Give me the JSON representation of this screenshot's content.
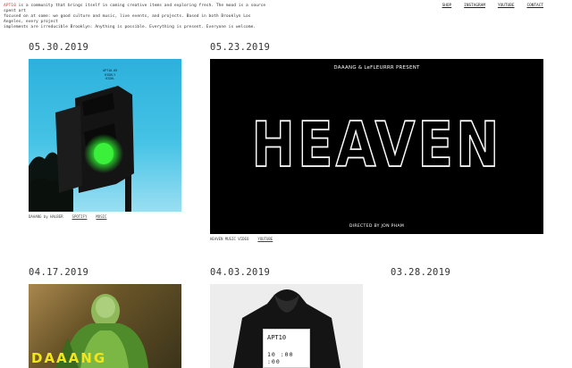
{
  "intro": {
    "brand": "APT10",
    "line1": " is a community that brings itself in coming creative items and exploring fresh. The mood is a source spent art",
    "line2": "focused on at some: we good culture and music, live events, and projects. Based in both Brooklyn Los Angeles, every project",
    "line3": "implements are irreducible Brooklyn: Anything is possible. Everything is present. Everyone is welcome."
  },
  "nav": {
    "shop": "SHOP",
    "instagram": "INSTAGRAM",
    "youtube": "YOUTUBE",
    "contact": "CONTACT"
  },
  "posts": [
    {
      "date": "05.30.2019",
      "image": {
        "label_line1": "APT10.05",
        "label_line2": "HIGHLY",
        "label_line3": "HIGHL"
      },
      "caption": "DAAANG by HALBER",
      "link1": "SPOTIFY",
      "link2": "MUSIC"
    },
    {
      "date": "05.23.2019",
      "image": {
        "present": "DAAANG & LeFLEURRR PRESENT",
        "title": "HEAVEN",
        "director": "DIRECTED BY JON PHAM"
      },
      "caption": "HEAVEN MUSIC VIDEO",
      "link1": "YOUTUBE"
    },
    {
      "date": "04.17.2019",
      "image": {
        "stamp": "DAAANG"
      }
    },
    {
      "date": "04.03.2019",
      "image": {
        "code": "APT10",
        "time": "10 :00 :00"
      }
    },
    {
      "date": "03.28.2019"
    }
  ],
  "colors": {
    "accent": "#e0362c",
    "sky": "#2cb1dc",
    "signal": "#2de02f",
    "stamp": "#f2e51c"
  }
}
